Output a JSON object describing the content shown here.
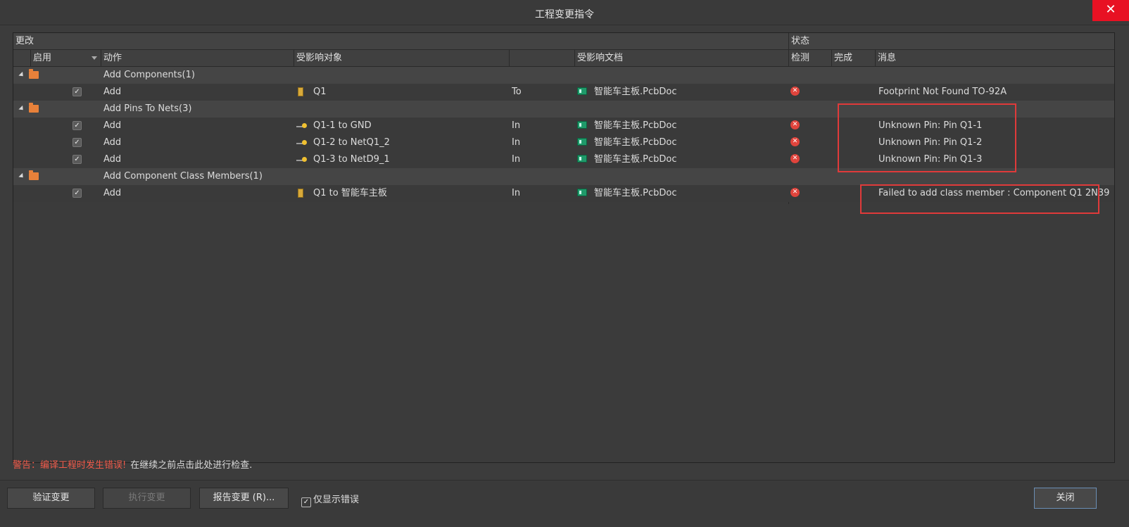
{
  "window": {
    "title": "工程变更指令",
    "close_glyph": "✕"
  },
  "headers": {
    "group_change": "更改",
    "group_status": "状态",
    "enable": "启用",
    "action": "动作",
    "affected_object": "受影响对象",
    "affected_document": "受影响文档",
    "check": "检测",
    "done": "完成",
    "message": "消息"
  },
  "rows": [
    {
      "type": "group",
      "label": "Add Components(1)"
    },
    {
      "type": "item",
      "checked": "✓",
      "action": "Add",
      "icon": "component-icon",
      "object": "Q1",
      "direction": "To",
      "document": "智能车主板.PcbDoc",
      "message": "Footprint Not Found TO-92A"
    },
    {
      "type": "group",
      "label": "Add Pins To Nets(3)"
    },
    {
      "type": "item",
      "checked": "✓",
      "action": "Add",
      "icon": "pin-icon",
      "object": "Q1-1 to GND",
      "direction": "In",
      "document": "智能车主板.PcbDoc",
      "message": "Unknown Pin: Pin Q1-1"
    },
    {
      "type": "item",
      "checked": "✓",
      "action": "Add",
      "icon": "pin-icon",
      "object": "Q1-2 to NetQ1_2",
      "direction": "In",
      "document": "智能车主板.PcbDoc",
      "message": "Unknown Pin: Pin Q1-2"
    },
    {
      "type": "item",
      "checked": "✓",
      "action": "Add",
      "icon": "pin-icon",
      "object": "Q1-3 to NetD9_1",
      "direction": "In",
      "document": "智能车主板.PcbDoc",
      "message": "Unknown Pin: Pin Q1-3"
    },
    {
      "type": "group",
      "label": "Add Component Class Members(1)"
    },
    {
      "type": "item",
      "checked": "✓",
      "action": "Add",
      "icon": "component-icon",
      "object": "Q1 to 智能车主板",
      "direction": "In",
      "document": "智能车主板.PcbDoc",
      "message": "Failed to add class member : Component Q1 2N39"
    }
  ],
  "warning": {
    "prefix": "警告：编译工程时发生错误!",
    "suffix": "在继续之前点击此处进行检查."
  },
  "footer": {
    "validate": "验证变更",
    "execute": "执行变更",
    "report": "报告变更 (R)...",
    "only_errors": "仅显示错误",
    "only_errors_checked": "✓",
    "close": "关闭"
  },
  "colors": {
    "background": "#3c3c3c",
    "error": "#e0443c",
    "warning_text": "#f05a4a",
    "highlight_box": "#e03a3a",
    "close_button": "#e81123"
  }
}
